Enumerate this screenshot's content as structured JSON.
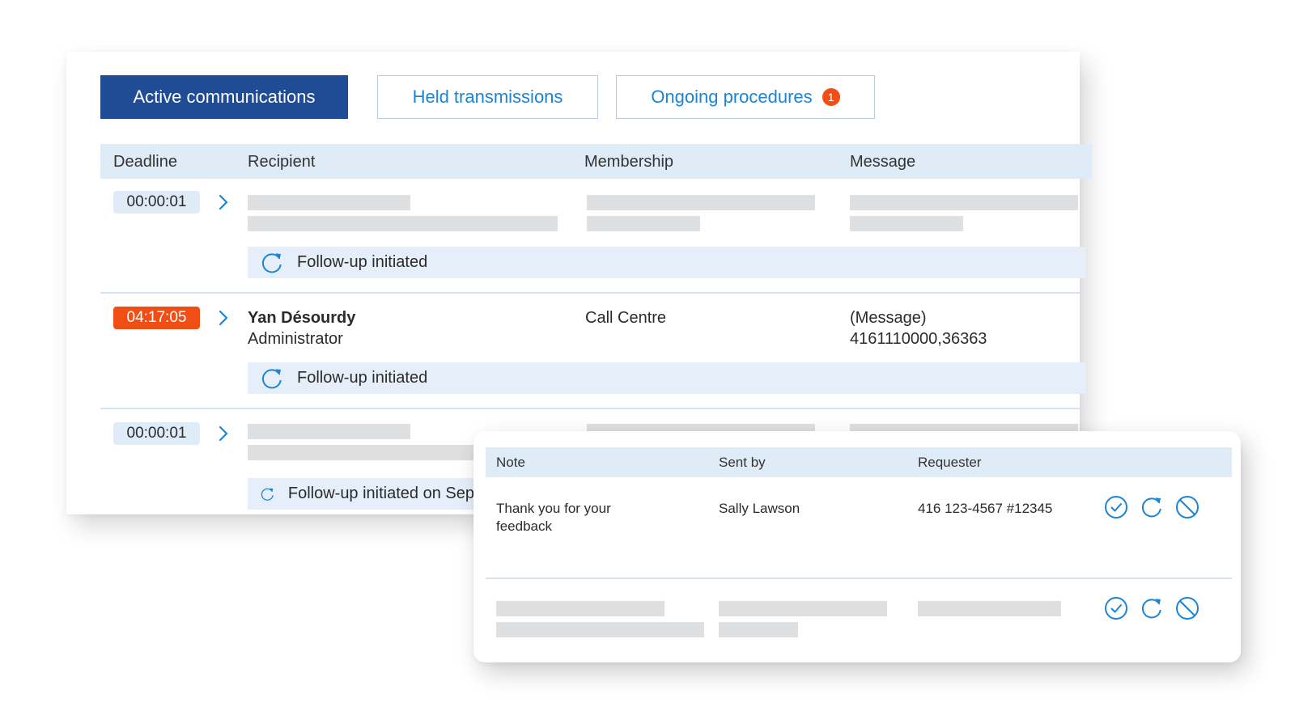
{
  "tabs": {
    "active": "Active communications",
    "held": "Held transmissions",
    "ongoing": "Ongoing procedures",
    "ongoing_badge": "1"
  },
  "table": {
    "headers": {
      "deadline": "Deadline",
      "recipient": "Recipient",
      "membership": "Membership",
      "message": "Message"
    },
    "rows": [
      {
        "deadline": "00:00:01",
        "status": "Follow-up initiated"
      },
      {
        "deadline": "04:17:05",
        "recipient_name": "Yan Désourdy",
        "recipient_role": "Administrator",
        "membership": "Call Centre",
        "message_line1": "(Message)",
        "message_line2": "4161110000,36363",
        "status": "Follow-up initiated"
      },
      {
        "deadline": "00:00:01",
        "status": "Follow-up initiated on Sep"
      }
    ]
  },
  "popup": {
    "headers": {
      "note": "Note",
      "sent_by": "Sent by",
      "requester": "Requester"
    },
    "rows": [
      {
        "note_line1": "Thank you for your",
        "note_line2": "feedback",
        "sent_by": "Sally Lawson",
        "requester": "416 123-4567 #12345"
      }
    ]
  },
  "colors": {
    "primary": "#1f4c94",
    "accent": "#1c84d6",
    "urgent": "#f04e15",
    "header_bg": "#dfecf8",
    "placeholder": "#dedfe0"
  },
  "icons": {
    "chevron": "chevron-right-icon",
    "refresh": "refresh-icon",
    "approve": "check-circle-icon",
    "block": "block-icon"
  }
}
